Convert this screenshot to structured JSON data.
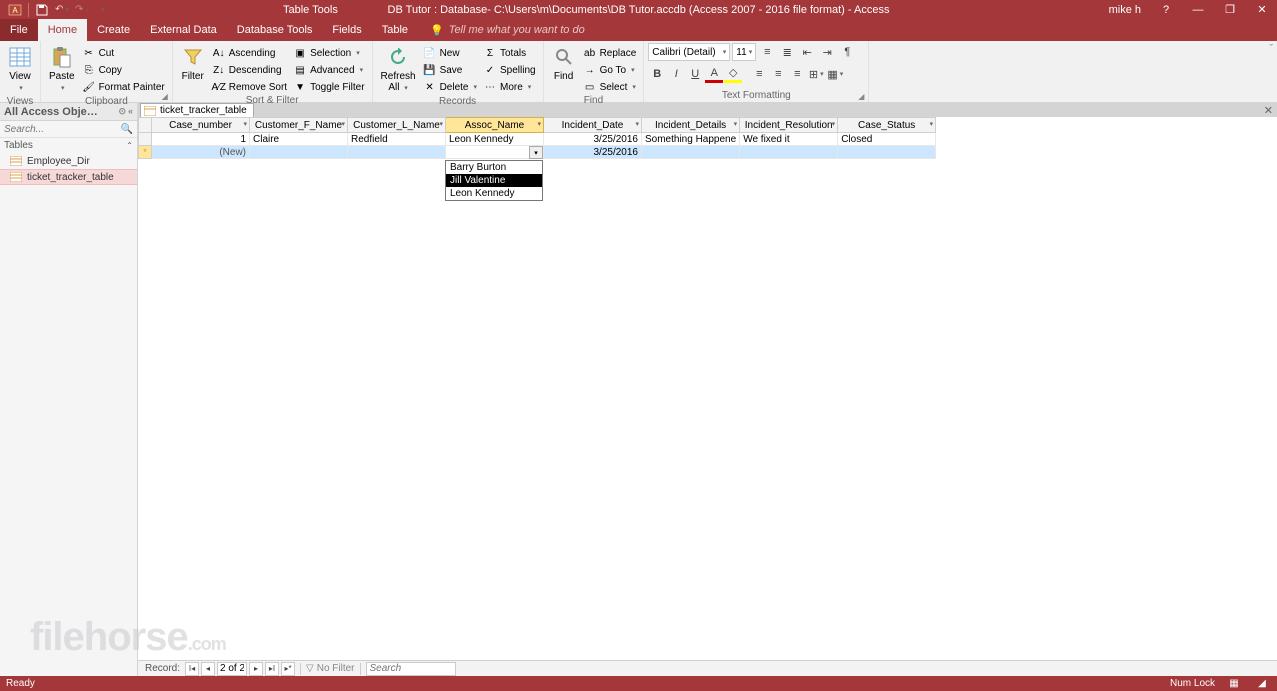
{
  "titlebar": {
    "tool_tab": "Table Tools",
    "title": "DB Tutor : Database- C:\\Users\\m\\Documents\\DB Tutor.accdb (Access 2007 - 2016 file format) - Access",
    "user": "mike h"
  },
  "tabs": {
    "file": "File",
    "home": "Home",
    "create": "Create",
    "external": "External Data",
    "dbtools": "Database Tools",
    "fields": "Fields",
    "table": "Table",
    "tellme": "Tell me what you want to do"
  },
  "ribbon": {
    "views": {
      "label": "Views",
      "view": "View"
    },
    "clipboard": {
      "label": "Clipboard",
      "paste": "Paste",
      "cut": "Cut",
      "copy": "Copy",
      "fmt": "Format Painter"
    },
    "sortfilter": {
      "label": "Sort & Filter",
      "filter": "Filter",
      "asc": "Ascending",
      "desc": "Descending",
      "remove": "Remove Sort",
      "selection": "Selection",
      "advanced": "Advanced",
      "toggle": "Toggle Filter"
    },
    "records": {
      "label": "Records",
      "refresh": "Refresh\nAll",
      "new": "New",
      "save": "Save",
      "delete": "Delete",
      "totals": "Totals",
      "spelling": "Spelling",
      "more": "More"
    },
    "find": {
      "label": "Find",
      "find": "Find",
      "replace": "Replace",
      "goto": "Go To",
      "select": "Select"
    },
    "textfmt": {
      "label": "Text Formatting",
      "font": "Calibri (Detail)",
      "size": "11"
    }
  },
  "nav": {
    "header": "All Access Obje…",
    "search_placeholder": "Search...",
    "group": "Tables",
    "items": [
      "Employee_Dir",
      "ticket_tracker_table"
    ]
  },
  "doc": {
    "tab": "ticket_tracker_table",
    "columns": [
      "Case_number",
      "Customer_F_Name",
      "Customer_L_Name",
      "Assoc_Name",
      "Incident_Date",
      "Incident_Details",
      "Incident_Resolution",
      "Case_Status"
    ],
    "rows": [
      {
        "case_number": "1",
        "f_name": "Claire",
        "l_name": "Redfield",
        "assoc": "Leon Kennedy",
        "date": "3/25/2016",
        "details": "Something Happene",
        "resolution": "We fixed it",
        "status": "Closed"
      }
    ],
    "new_row": {
      "label": "(New)",
      "date": "3/25/2016"
    },
    "dropdown": {
      "options": [
        "Barry Burton",
        "Jill Valentine",
        "Leon Kennedy"
      ],
      "highlighted_index": 1
    },
    "record_nav": {
      "label": "Record:",
      "pos": "2 of 2",
      "filter": "No Filter",
      "search": "Search"
    }
  },
  "statusbar": {
    "left": "Ready",
    "numlock": "Num Lock"
  },
  "watermark": {
    "name": "filehorse",
    "suffix": ".com"
  }
}
